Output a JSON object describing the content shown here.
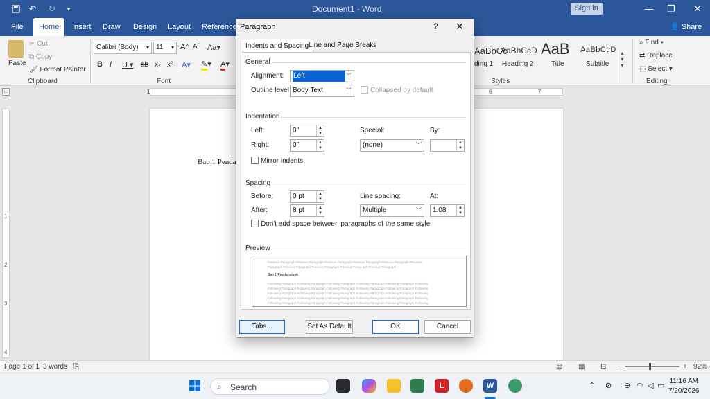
{
  "app": {
    "document_title": "Document1 - Word",
    "sign_in": "Sign in"
  },
  "ribbon": {
    "tabs": [
      "File",
      "Home",
      "Insert",
      "Draw",
      "Design",
      "Layout",
      "References"
    ],
    "active_tab": "Home",
    "share": "Share",
    "clipboard": {
      "paste": "Paste",
      "cut": "Cut",
      "copy": "Copy",
      "format_painter": "Format Painter",
      "label": "Clipboard"
    },
    "font": {
      "name": "Calibri (Body)",
      "size": "11",
      "label": "Font"
    },
    "styles": {
      "items": [
        "AaBbCc",
        "AaBbCcD",
        "AaB",
        "AaBbCcD"
      ],
      "names": [
        "ding 1",
        "Heading 2",
        "Title",
        "Subtitle"
      ],
      "label": "Styles"
    },
    "editing": {
      "find": "Find",
      "replace": "Replace",
      "select": "Select",
      "label": "Editing"
    }
  },
  "document": {
    "text": "Bab 1 Penda"
  },
  "ruler": {
    "h_numbers": [
      "1",
      "6",
      "7"
    ],
    "v_numbers": [
      "1",
      "2",
      "3",
      "4"
    ]
  },
  "statusbar": {
    "page": "Page 1 of 1",
    "words": "3 words",
    "zoom": "92%"
  },
  "taskbar": {
    "search": "Search",
    "time": "11:16 AM",
    "date": "7/20/2026"
  },
  "dialog": {
    "title": "Paragraph",
    "help": "?",
    "tabs": [
      "Indents and Spacing",
      "Line and Page Breaks"
    ],
    "general": {
      "heading": "General",
      "alignment_label": "Alignment:",
      "alignment_value": "Left",
      "outline_label": "Outline level:",
      "outline_value": "Body Text",
      "collapsed_label": "Collapsed by default"
    },
    "indentation": {
      "heading": "Indentation",
      "left_label": "Left:",
      "left_value": "0\"",
      "right_label": "Right:",
      "right_value": "0\"",
      "special_label": "Special:",
      "special_value": "(none)",
      "by_label": "By:",
      "by_value": "",
      "mirror_label": "Mirror indents"
    },
    "spacing": {
      "heading": "Spacing",
      "before_label": "Before:",
      "before_value": "0 pt",
      "after_label": "After:",
      "after_value": "8 pt",
      "line_label": "Line spacing:",
      "line_value": "Multiple",
      "at_label": "At:",
      "at_value": "1.08",
      "dont_add_label": "Don't add space between paragraphs of the same style"
    },
    "preview": {
      "heading": "Preview",
      "prev_line1": "Previous Paragraph Previous Paragraph Previous Paragraph Previous Paragraph Previous Paragraph Previous",
      "prev_line2": "Paragraph Previous Paragraph Previous Paragraph Previous Paragraph Previous Paragraph",
      "main": "Bab 1 Pendahuluan",
      "follow_line": "Following Paragraph Following Paragraph Following Paragraph Following Paragraph Following Paragraph Following"
    },
    "buttons": {
      "tabs": "Tabs...",
      "set_default": "Set As Default",
      "ok": "OK",
      "cancel": "Cancel"
    }
  }
}
